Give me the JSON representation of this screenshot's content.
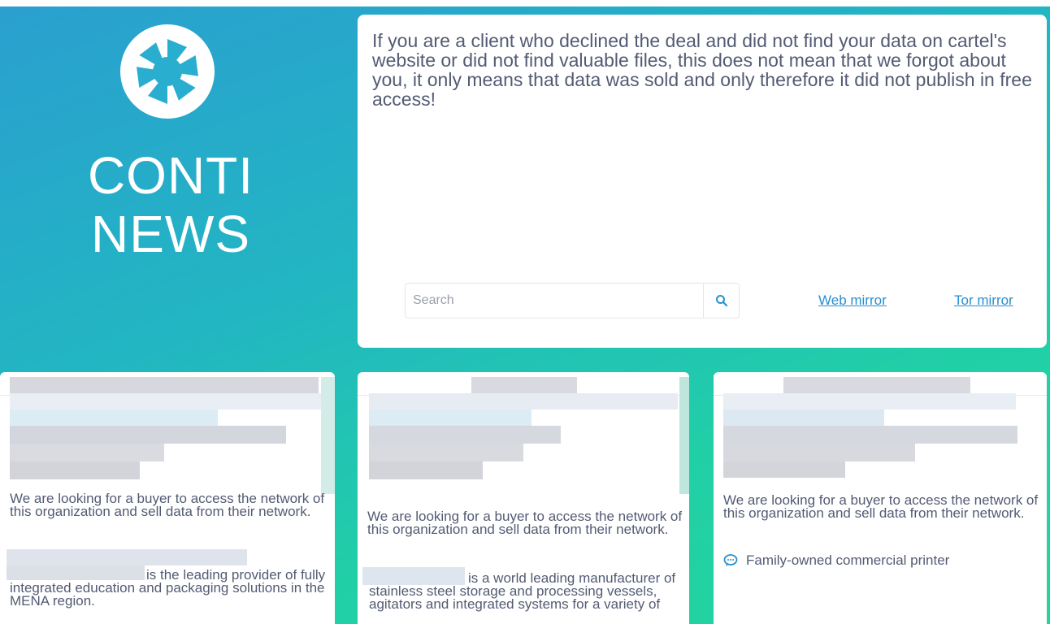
{
  "brand": {
    "line1": "CONTI",
    "line2": "NEWS"
  },
  "notice": {
    "text": "If you are a client who declined the deal and did not find your data on cartel's website or did not find valuable files, this does not mean that we forgot about you, it only means that data was sold and only therefore it did not publish in free access!"
  },
  "search": {
    "placeholder": "Search",
    "icon": "search-icon"
  },
  "mirrors": {
    "web": "Web mirror",
    "tor": "Tor mirror"
  },
  "cards": [
    {
      "description": "We are looking for a buyer to access the network of this organization and sell data from their network.",
      "sub": "is the leading provider of fully integrated education and packaging solutions in the MENA region."
    },
    {
      "description": "We are looking for a buyer to access the network of this organization and sell data from their network.",
      "sub": "is a world leading manufacturer of stainless steel storage and processing vessels, agitators and integrated systems for a variety of"
    },
    {
      "description": "We are looking for a buyer to access the network of this organization and sell data from their network.",
      "sub": "Family-owned commercial printer",
      "sub_icon": "chat-bubble-icon"
    }
  ],
  "colors": {
    "accent_link": "#2a8fd0",
    "gradient_start": "#2a9fd0",
    "gradient_end": "#24d59b"
  }
}
